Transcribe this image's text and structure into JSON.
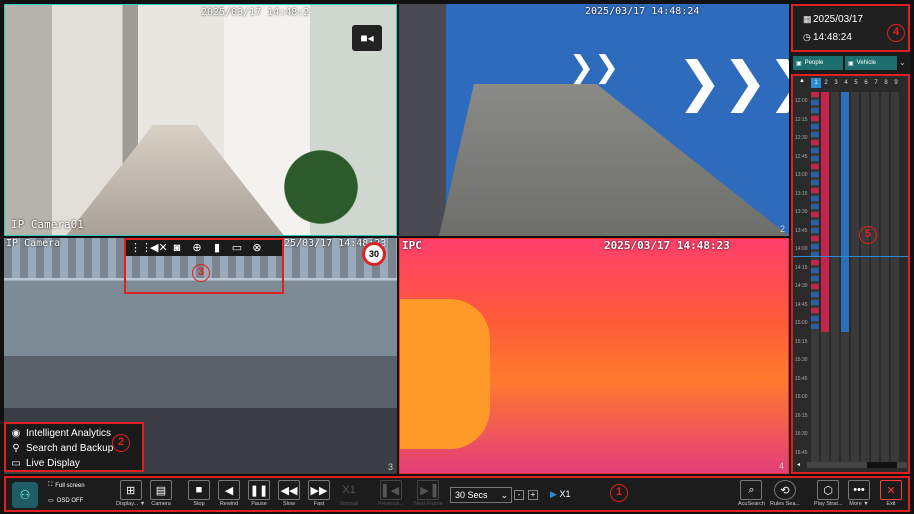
{
  "cameras": {
    "cam1": {
      "osd_time": "2025/03/17 14:48:2",
      "label": "IP Camera01",
      "index": "1"
    },
    "cam2": {
      "osd_time": "2025/03/17 14:48:24",
      "index": "2"
    },
    "cam3": {
      "label": "IP Camera",
      "osd_time": "25/03/17 14:48:23",
      "index": "3",
      "badge": "30"
    },
    "cam4": {
      "label": "IPC",
      "osd_time": "2025/03/17 14:48:23",
      "index": "4"
    }
  },
  "left_menu": {
    "items": [
      "Intelligent Analytics",
      "Search and Backup",
      "Live Display"
    ]
  },
  "right_panel": {
    "date": "2025/03/17",
    "time": "14:48:24",
    "filter_people": "People",
    "filter_vehicle": "Vehicle",
    "channels": [
      "1",
      "2",
      "3",
      "4",
      "5",
      "6",
      "7",
      "8",
      "9"
    ],
    "ticks": [
      "12:00",
      "12:15",
      "12:30",
      "12:45",
      "13:00",
      "13:15",
      "13:30",
      "13:45",
      "14:00",
      "14:15",
      "14:30",
      "14:45",
      "15:00",
      "15:15",
      "15:30",
      "15:45",
      "16:00",
      "16:15",
      "16:30",
      "16:45"
    ]
  },
  "bottom_bar": {
    "full_screen": "Full screen",
    "osd_off": "OSD OFF",
    "display": "Display... ▼",
    "camera": "Camera",
    "stop": "Stop",
    "rewind": "Rewind",
    "pause": "Pause",
    "slow": "Slow",
    "fast": "Fast",
    "x1_disabled": "X1",
    "normal": "Normal",
    "previous": "Previous...",
    "next_frame": "Next Frame",
    "interval": "30 Secs",
    "minus": "-",
    "plus": "+",
    "speed": "X1",
    "acusearch": "AcuSearch",
    "rules_search": "Rules Sea...",
    "play_strategy": "Play Strat...",
    "more": "More ▼",
    "exit": "Exit"
  },
  "badges": [
    "1",
    "2",
    "3",
    "4",
    "5"
  ],
  "colors": {
    "accent": "#e02020",
    "selected": "#2a8bd6",
    "teal": "#1d6f6f"
  }
}
